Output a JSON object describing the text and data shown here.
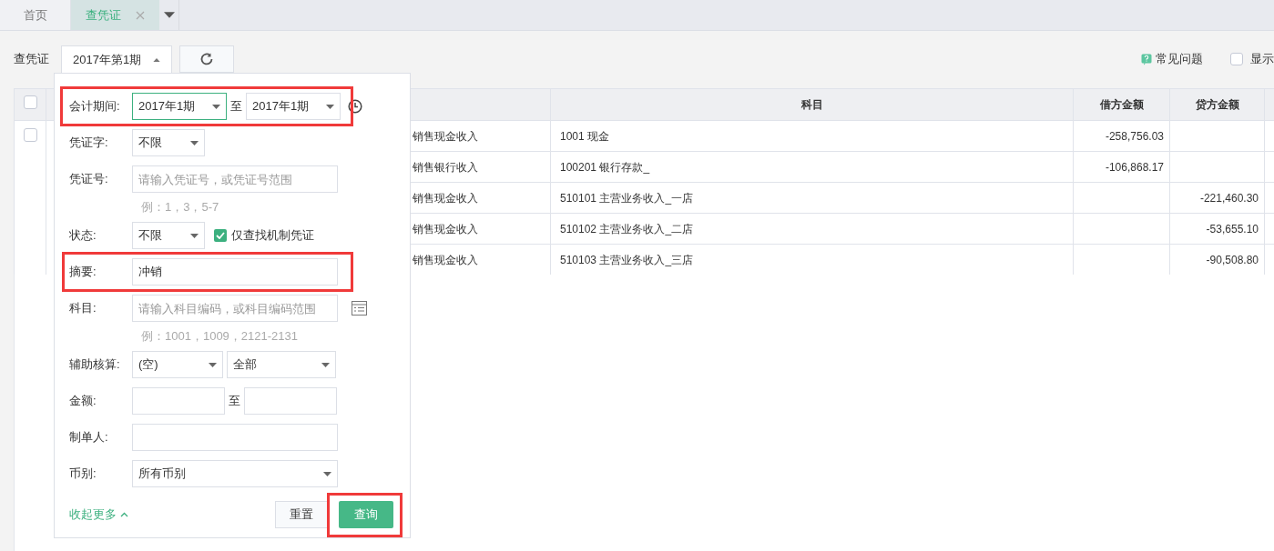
{
  "tabs": [
    {
      "label": "首页",
      "selected": false,
      "closable": false
    },
    {
      "label": "查凭证",
      "selected": true,
      "closable": true
    }
  ],
  "toolbar": {
    "label": "查凭证",
    "period": "2017年第1期",
    "period_open": true
  },
  "help_link": "常见问题",
  "show_option": {
    "label": "显示",
    "checked": false
  },
  "table": {
    "all_checked": false,
    "columns": [
      "科目",
      "借方金额",
      "贷方金额"
    ],
    "vouchers": [
      {
        "checked": false,
        "entries": [
          {
            "summary": "销售现金收入",
            "account": "1001 现金",
            "debit": "-258,756.03"
          },
          {
            "summary": "销售银行收入",
            "account": "100201 银行存款_",
            "debit": "-106,868.17"
          },
          {
            "summary": "销售现金收入",
            "account": "510101 主营业务收入_一店",
            "credit": "-221,460.30"
          },
          {
            "summary": "销售现金收入",
            "account": "510102 主营业务收入_二店",
            "credit": "-53,655.10"
          },
          {
            "summary": "销售现金收入",
            "account": "510103 主营业务收入_三店",
            "credit": "-90,508.80"
          }
        ]
      }
    ]
  },
  "filter": {
    "period": {
      "label": "会计期间:",
      "from": "2017年1期",
      "separator": "至",
      "to": "2017年1期",
      "highlighted": true
    },
    "voucher_type": {
      "label": "凭证字:",
      "value": "不限"
    },
    "voucher_no": {
      "label": "凭证号:",
      "placeholder": "请输入凭证号，或凭证号范围",
      "hint": "例：1，3，5-7"
    },
    "status": {
      "label": "状态:",
      "value": "不限",
      "machine_only": {
        "label": "仅查找机制凭证",
        "checked": true
      }
    },
    "summary": {
      "label": "摘要:",
      "value": "冲销",
      "highlighted": true
    },
    "account": {
      "label": "科目:",
      "placeholder": "请输入科目编码，或科目编码范围",
      "hint": "例：1001，1009，2121-2131"
    },
    "auxiliary": {
      "label": "辅助核算:",
      "type": "(空)",
      "item": "全部"
    },
    "amount": {
      "label": "金额:",
      "separator": "至"
    },
    "creator": {
      "label": "制单人:"
    },
    "currency": {
      "label": "币别:",
      "value": "所有币别"
    },
    "collapse_link": "收起更多",
    "reset": "重置",
    "query": {
      "label": "查询",
      "highlighted": true
    }
  }
}
